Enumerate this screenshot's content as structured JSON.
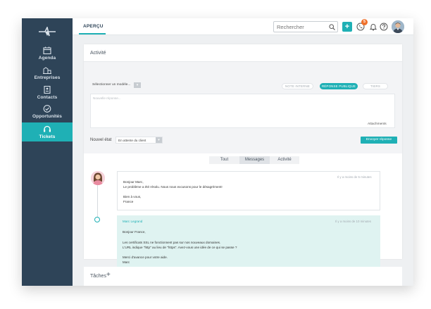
{
  "sidebar": {
    "items": [
      {
        "label": "Agenda",
        "icon": "calendar-icon",
        "active": false
      },
      {
        "label": "Entreprises",
        "icon": "buildings-icon",
        "active": false
      },
      {
        "label": "Contacts",
        "icon": "contact-card-icon",
        "active": false
      },
      {
        "label": "Opportunités",
        "icon": "check-circle-icon",
        "active": false
      },
      {
        "label": "Tickets",
        "icon": "headset-icon",
        "active": true
      }
    ]
  },
  "topbar": {
    "tab_label": "APERÇU",
    "search_placeholder": "Rechercher",
    "notification_count": "5"
  },
  "activity": {
    "title": "Activité",
    "select_modele": "Sélectionner un modèle...",
    "reply_modes": [
      "NOTE INTERNE",
      "RÉPONSE PUBLIQUE",
      "TIERS"
    ],
    "active_mode": "RÉPONSE PUBLIQUE",
    "reply_placeholder": "Nouvelle réponse...",
    "attachments_label": "Attachments",
    "nouvel_etat_label": "Nouvel état",
    "etat_value": "En attente du client",
    "send_label": "Envoyer réponse",
    "filters": [
      "Tout",
      "Messages",
      "Activité"
    ],
    "selected_filter": "Messages"
  },
  "messages": [
    {
      "time": "Il y a moins de 5 minutes",
      "lines": [
        "Bonjour Marc,",
        "Le problème a été résolu. Nous nous excusons pour le désagrément!",
        "Bien à vous,",
        "France"
      ]
    },
    {
      "author": "Marc Legrand",
      "time": "Il y a moins de 10 minutes",
      "lines": [
        "Bonjour France,",
        "Les certificats SSL ne fonctionnent pas sur nos nouveaux domaines.",
        "L'URL indique \"http\" au lieu de \"https\". Avez-vous une idée de ce qui se passe ?",
        "Merci d'avance pour votre aide.",
        "Marc"
      ]
    }
  ],
  "taches": {
    "label": "Tâches",
    "add_symbol": "+"
  },
  "colors": {
    "sidebar_bg": "#2e4458",
    "accent": "#1fb0b5",
    "badge": "#f0712c",
    "message_highlight_bg": "#dff3f1"
  }
}
